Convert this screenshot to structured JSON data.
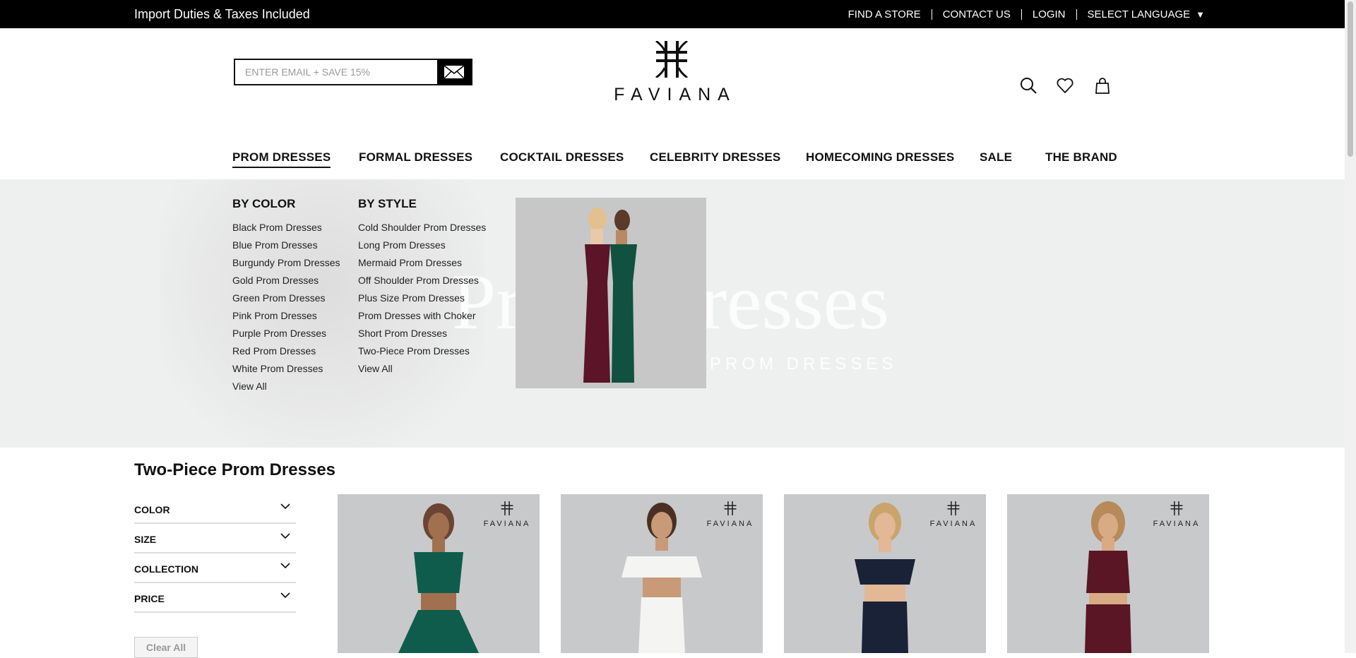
{
  "topbar": {
    "promo": "Import Duties & Taxes Included",
    "links": [
      "FIND A STORE",
      "CONTACT US",
      "LOGIN",
      "SELECT LANGUAGE"
    ],
    "language_arrow": "▼"
  },
  "header": {
    "email_placeholder": "ENTER EMAIL + SAVE 15%",
    "logo_text": "FAVIANA",
    "icons": [
      "search-icon",
      "heart-icon",
      "bag-icon"
    ]
  },
  "nav": {
    "items": [
      "PROM DRESSES",
      "FORMAL DRESSES",
      "COCKTAIL DRESSES",
      "CELEBRITY DRESSES",
      "HOMECOMING DRESSES",
      "SALE",
      "THE BRAND"
    ],
    "active": "PROM DRESSES"
  },
  "hero": {
    "title": "Prom Dresses",
    "subtitle": "PROM DRESSES"
  },
  "mega_menu": {
    "by_color": {
      "heading": "BY COLOR",
      "links": [
        "Black Prom Dresses",
        "Blue Prom Dresses",
        "Burgundy Prom Dresses",
        "Gold Prom Dresses",
        "Green Prom Dresses",
        "Pink Prom Dresses",
        "Purple Prom Dresses",
        "Red Prom Dresses",
        "White Prom Dresses",
        "View All"
      ]
    },
    "by_style": {
      "heading": "BY STYLE",
      "links": [
        "Cold Shoulder Prom Dresses",
        "Long Prom Dresses",
        "Mermaid Prom Dresses",
        "Off Shoulder Prom Dresses",
        "Plus Size Prom Dresses",
        "Prom Dresses with Choker",
        "Short Prom Dresses",
        "Two-Piece Prom Dresses",
        "View All"
      ]
    }
  },
  "page": {
    "title": "Two-Piece Prom Dresses"
  },
  "filters": {
    "items": [
      "COLOR",
      "SIZE",
      "COLLECTION",
      "PRICE"
    ],
    "clear_label": "Clear All"
  },
  "products": {
    "brand_label": "FAVIANA",
    "dress_colors": [
      "#0f5c4d",
      "#f4f4f2",
      "#1a2238",
      "#5a1624"
    ]
  },
  "colors": {
    "topbar_bg": "#000000",
    "hero_bg": "#eef0ef",
    "product_bg": "#c8c9ca"
  }
}
